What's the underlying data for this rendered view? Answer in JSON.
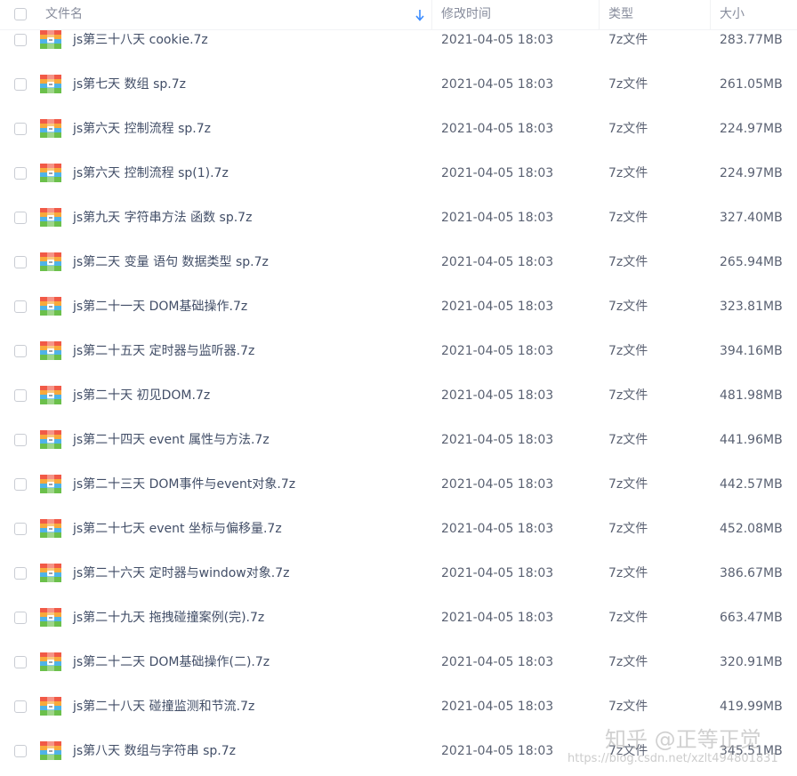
{
  "header": {
    "name_label": "文件名",
    "time_label": "修改时间",
    "type_label": "类型",
    "size_label": "大小"
  },
  "files": [
    {
      "name": "js第三十八天 cookie.7z",
      "modified": "2021-04-05 18:03",
      "type": "7z文件",
      "size": "283.77MB"
    },
    {
      "name": "js第七天 数组 sp.7z",
      "modified": "2021-04-05 18:03",
      "type": "7z文件",
      "size": "261.05MB"
    },
    {
      "name": "js第六天 控制流程 sp.7z",
      "modified": "2021-04-05 18:03",
      "type": "7z文件",
      "size": "224.97MB"
    },
    {
      "name": "js第六天 控制流程 sp(1).7z",
      "modified": "2021-04-05 18:03",
      "type": "7z文件",
      "size": "224.97MB"
    },
    {
      "name": "js第九天 字符串方法 函数 sp.7z",
      "modified": "2021-04-05 18:03",
      "type": "7z文件",
      "size": "327.40MB"
    },
    {
      "name": "js第二天 变量 语句 数据类型 sp.7z",
      "modified": "2021-04-05 18:03",
      "type": "7z文件",
      "size": "265.94MB"
    },
    {
      "name": "js第二十一天 DOM基础操作.7z",
      "modified": "2021-04-05 18:03",
      "type": "7z文件",
      "size": "323.81MB"
    },
    {
      "name": "js第二十五天 定时器与监听器.7z",
      "modified": "2021-04-05 18:03",
      "type": "7z文件",
      "size": "394.16MB"
    },
    {
      "name": "js第二十天 初见DOM.7z",
      "modified": "2021-04-05 18:03",
      "type": "7z文件",
      "size": "481.98MB"
    },
    {
      "name": "js第二十四天 event 属性与方法.7z",
      "modified": "2021-04-05 18:03",
      "type": "7z文件",
      "size": "441.96MB"
    },
    {
      "name": "js第二十三天 DOM事件与event对象.7z",
      "modified": "2021-04-05 18:03",
      "type": "7z文件",
      "size": "442.57MB"
    },
    {
      "name": "js第二十七天 event 坐标与偏移量.7z",
      "modified": "2021-04-05 18:03",
      "type": "7z文件",
      "size": "452.08MB"
    },
    {
      "name": "js第二十六天 定时器与window对象.7z",
      "modified": "2021-04-05 18:03",
      "type": "7z文件",
      "size": "386.67MB"
    },
    {
      "name": "js第二十九天 拖拽碰撞案例(完).7z",
      "modified": "2021-04-05 18:03",
      "type": "7z文件",
      "size": "663.47MB"
    },
    {
      "name": "js第二十二天 DOM基础操作(二).7z",
      "modified": "2021-04-05 18:03",
      "type": "7z文件",
      "size": "320.91MB"
    },
    {
      "name": "js第二十八天 碰撞监测和节流.7z",
      "modified": "2021-04-05 18:03",
      "type": "7z文件",
      "size": "419.99MB"
    },
    {
      "name": "js第八天 数组与字符串 sp.7z",
      "modified": "2021-04-05 18:03",
      "type": "7z文件",
      "size": "345.51MB"
    }
  ],
  "watermark": {
    "text": "知乎 @正等正觉",
    "url": "https://blog.csdn.net/xzlt494801831"
  },
  "colors": {
    "sort_arrow": "#3b8cff",
    "text_primary": "#424e67",
    "text_header": "#878c9c"
  },
  "icons": {
    "archive": "7z-archive-icon",
    "sort": "sort-down-arrow-icon"
  }
}
